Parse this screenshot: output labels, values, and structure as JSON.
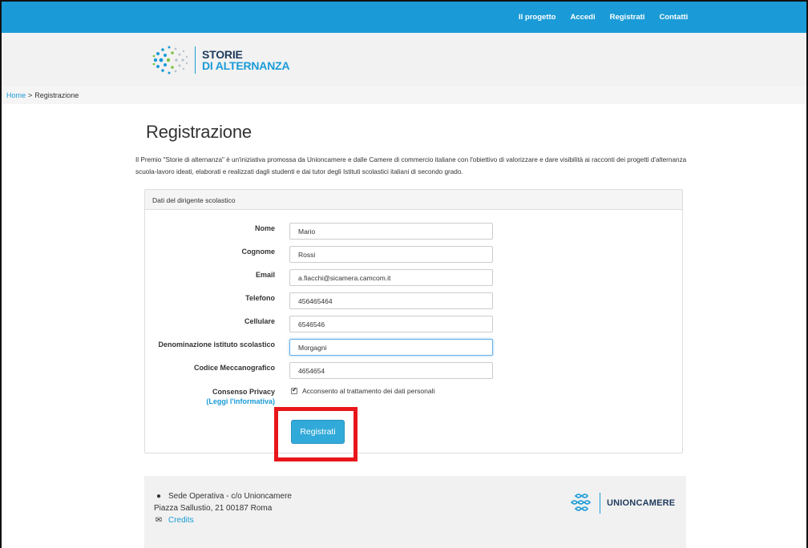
{
  "topnav": [
    "Il progetto",
    "Accedi",
    "Registrati",
    "Contatti"
  ],
  "logo": {
    "line1": "STORIE",
    "line2": "DI ALTERNANZA"
  },
  "breadcrumb": {
    "home": "Home",
    "separator": ">",
    "current": "Registrazione"
  },
  "page": {
    "title": "Registrazione",
    "intro": "Il Premio \"Storie di alternanza\" è un'iniziativa promossa da Unioncamere e dalle Camere di commercio italiane con l'obiettivo di valorizzare e dare visibilità ai racconti dei progetti d'alternanza scuola-lavoro ideati, elaborati e realizzati dagli studenti e dai tutor degli Istituti scolastici italiani di secondo grado."
  },
  "form": {
    "panel_title": "Dati del dirigente scolastico",
    "fields": [
      {
        "label": "Nome",
        "value": "Mario"
      },
      {
        "label": "Cognome",
        "value": "Rossi"
      },
      {
        "label": "Email",
        "value": "a.fiacchi@sicamera.camcom.it"
      },
      {
        "label": "Telefono",
        "value": "456465464"
      },
      {
        "label": "Cellulare",
        "value": "6546546"
      },
      {
        "label": "Denominazione istituto scolastico",
        "value": "Morgagni"
      },
      {
        "label": "Codice Meccanografico",
        "value": "4654654"
      }
    ],
    "consent_label": "Consenso Privacy",
    "consent_link": "(Leggi l'informativa)",
    "consent_text": "Acconsento al trattamento dei dati personali",
    "submit": "Registrati"
  },
  "footer": {
    "address1": "Sede Operativa - c/o Unioncamere",
    "address2": "Piazza Sallustio, 21 00187 Roma",
    "credits": "Credits",
    "brand": "UNIONCAMERE"
  },
  "colors": {
    "accent": "#1a9bd7",
    "highlight": "#e8161b",
    "button": "#32aad9"
  }
}
